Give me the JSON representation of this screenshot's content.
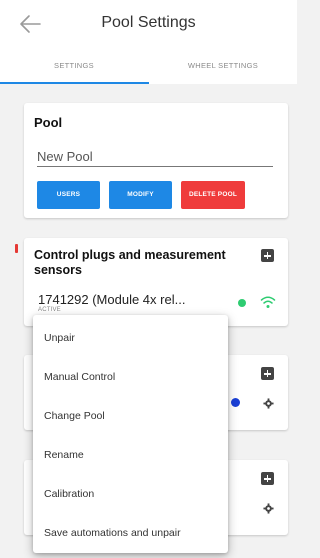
{
  "appbar": {
    "title": "Pool Settings",
    "back_icon": "arrow-left-icon"
  },
  "tabs": [
    {
      "label": "SETTINGS",
      "active": true
    },
    {
      "label": "WHEEL SETTINGS",
      "active": false
    }
  ],
  "pool_card": {
    "title": "Pool",
    "name_value": "New Pool",
    "buttons": {
      "users": "USERS",
      "modify": "MODIFY",
      "delete": "DELETE POOL"
    }
  },
  "sensors_card": {
    "title": "Control plugs and measurement sensors",
    "device_name": "1741292 (Module 4x rel...",
    "device_sub": "ACTIVE"
  },
  "menu": {
    "items": [
      "Unpair",
      "Manual Control",
      "Change Pool",
      "Rename",
      "Calibration",
      "Save automations and unpair"
    ]
  },
  "colors": {
    "accent": "#1e88e5",
    "danger": "#ef3b3b",
    "status_green": "#2ecc71",
    "status_blue": "#1a3fd6"
  }
}
